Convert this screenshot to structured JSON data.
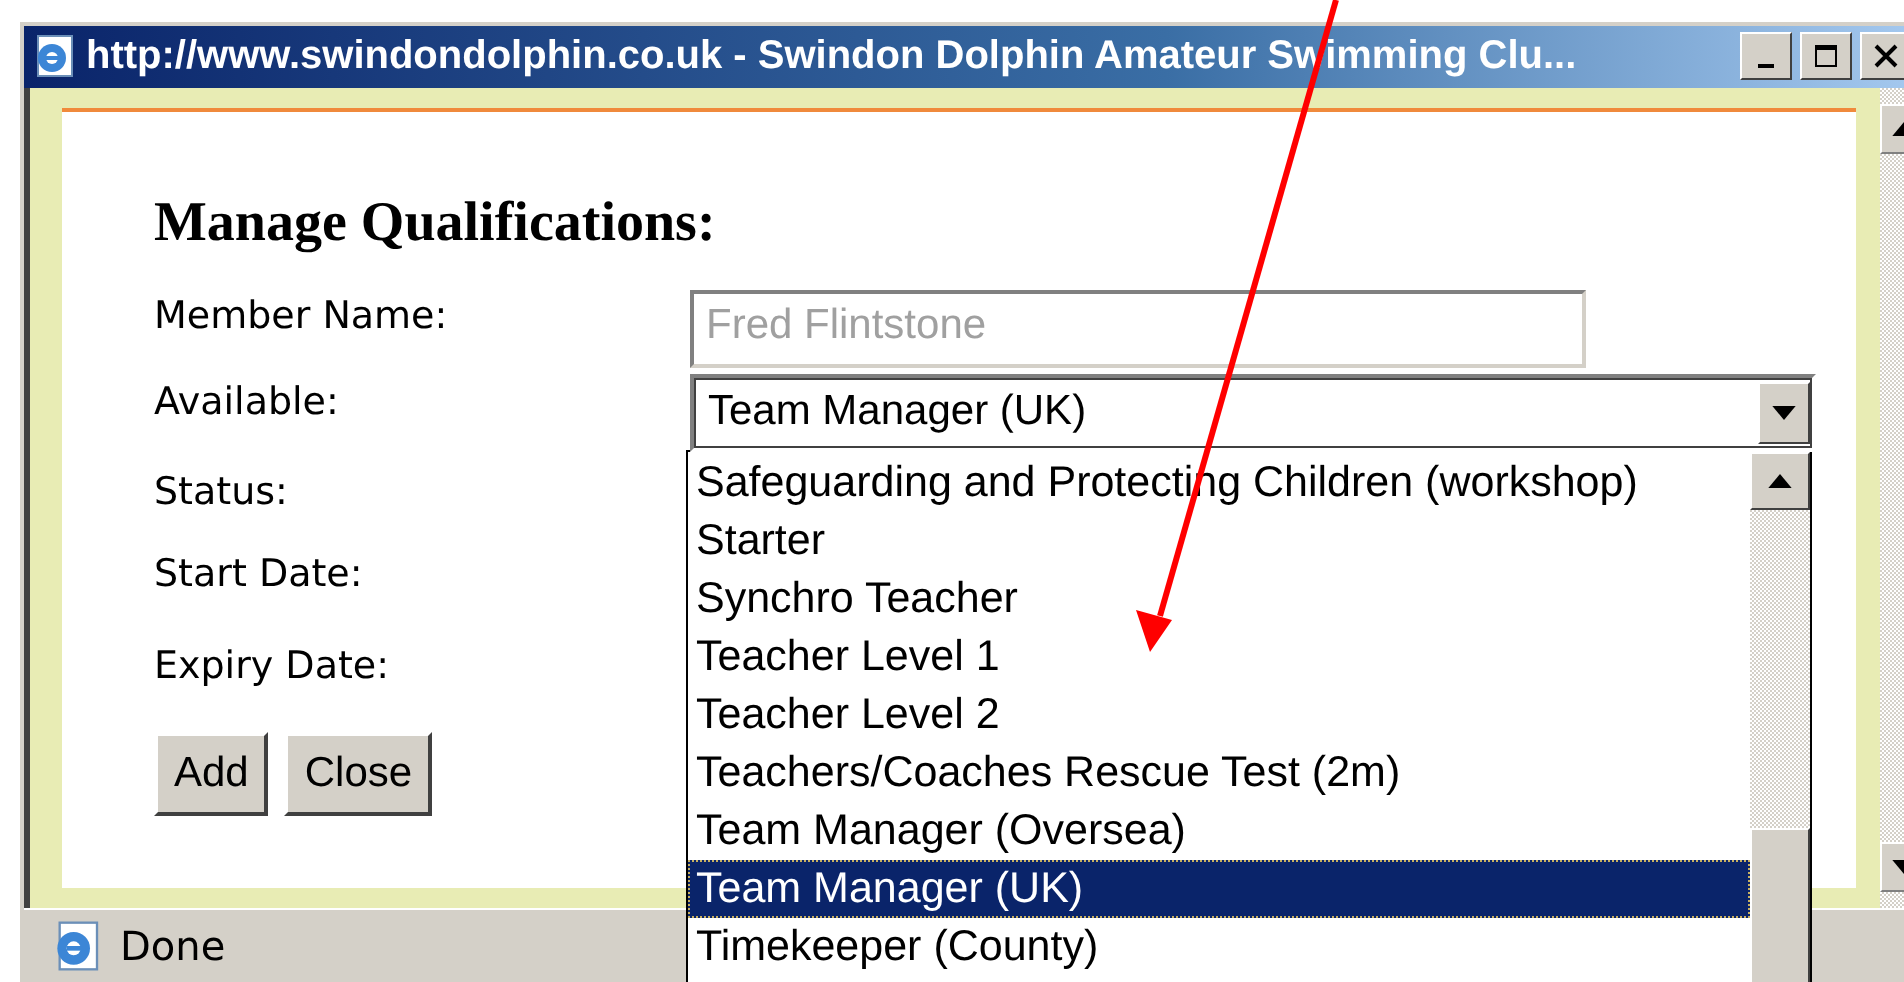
{
  "window": {
    "title": "http://www.swindondolphin.co.uk - Swindon Dolphin Amateur Swimming Clu..."
  },
  "form": {
    "heading": "Manage Qualifications:",
    "fields": [
      {
        "label": "Member Name:",
        "kind": "text",
        "value": "Fred Flintstone",
        "disabled": true
      },
      {
        "label": "Available:",
        "kind": "select",
        "value": "Team Manager (UK)",
        "expanded": true
      },
      {
        "label": "Status:",
        "kind": "label"
      },
      {
        "label": "Start Date:",
        "kind": "label"
      },
      {
        "label": "Expiry Date:",
        "kind": "label"
      }
    ],
    "buttons": [
      "Add",
      "Close"
    ]
  },
  "dropdown": {
    "options": [
      {
        "label": "Safeguarding and Protecting Children (workshop)",
        "selected": false
      },
      {
        "label": "Starter",
        "selected": false
      },
      {
        "label": "Synchro Teacher",
        "selected": false
      },
      {
        "label": "Teacher Level 1",
        "selected": false
      },
      {
        "label": "Teacher Level 2",
        "selected": false
      },
      {
        "label": "Teachers/Coaches Rescue Test (2m)",
        "selected": false
      },
      {
        "label": "Team Manager (Oversea)",
        "selected": false
      },
      {
        "label": "Team Manager (UK)",
        "selected": true
      },
      {
        "label": "Timekeeper (County)",
        "selected": false
      }
    ]
  },
  "status_bar": {
    "text": "Done"
  }
}
